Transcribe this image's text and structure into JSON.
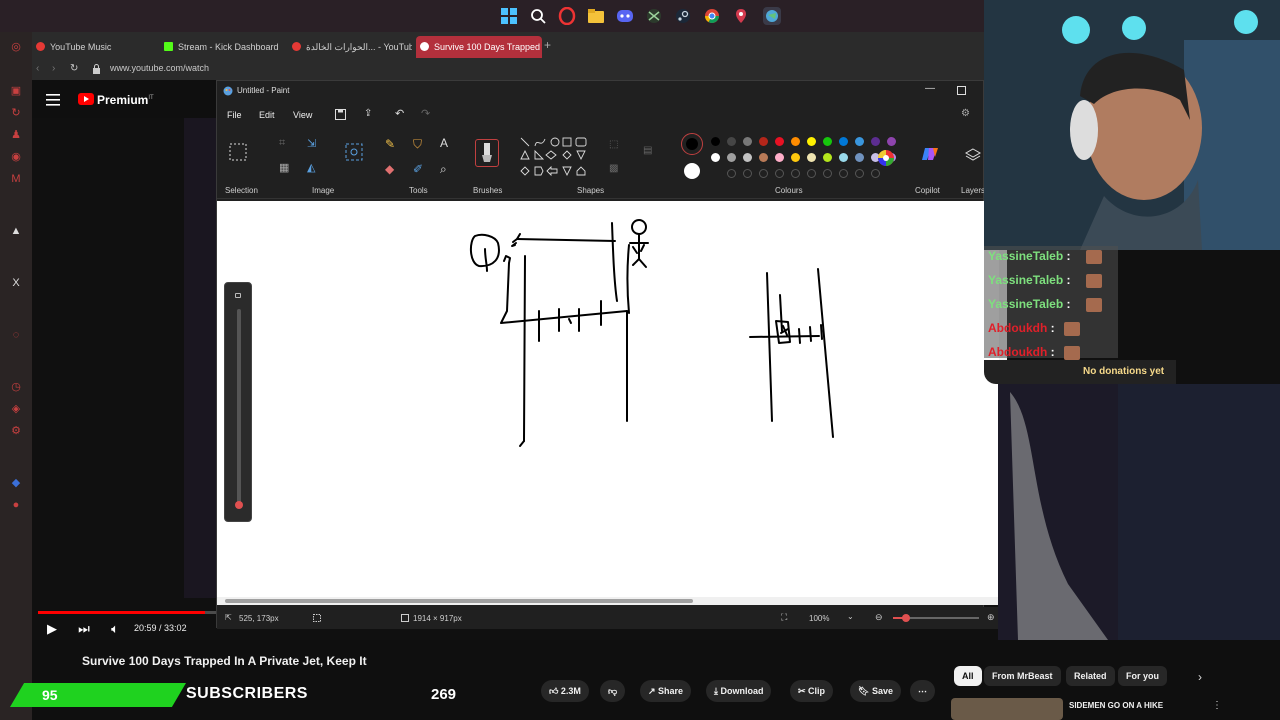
{
  "taskbar": {
    "icons": [
      "windows-icon",
      "search-icon",
      "opera-icon",
      "folder-icon",
      "discord-icon",
      "xbox-icon",
      "steam-icon",
      "chrome-icon",
      "maps-icon",
      "opera-gx-icon"
    ]
  },
  "browser": {
    "tabs": [
      {
        "label": "YouTube Music",
        "icon_color": "#e53935"
      },
      {
        "label": "Stream - Kick Dashboard",
        "icon_color": "#53fc18"
      },
      {
        "label": "الحوارات الخالدة... - YouTube",
        "icon_color": "#e53935"
      },
      {
        "label": "Survive 100 Days Trapped",
        "icon_color": "#ffffff"
      }
    ],
    "url": "www.youtube.com/watch"
  },
  "youtube": {
    "logo_text": "Premium",
    "logo_region": "IT",
    "time_current": "20:59",
    "time_total": "33:02",
    "progress_fraction": 0.135,
    "video_title": "Survive 100 Days Trapped In A Private Jet, Keep It",
    "actions": {
      "likes": "2.3M",
      "share": "Share",
      "download": "Download",
      "clip": "Clip",
      "save": "Save"
    },
    "chips": [
      "All",
      "From MrBeast",
      "Related",
      "For you"
    ],
    "rec_title": "SIDEMEN GO ON A HIKE"
  },
  "paint": {
    "title": "Untitled - Paint",
    "menu": [
      "File",
      "Edit",
      "View"
    ],
    "groups": {
      "selection": "Selection",
      "image": "Image",
      "tools": "Tools",
      "brushes": "Brushes",
      "shapes": "Shapes",
      "colours": "Colours",
      "copilot": "Copilot",
      "layers": "Layers"
    },
    "palette_row1": [
      "#000000",
      "#464646",
      "#787878",
      "#b4261a",
      "#e81123",
      "#ff8c00",
      "#fff100",
      "#16c60c",
      "#0078d7",
      "#3a96dd",
      "#5c2d91",
      "#8e44ad"
    ],
    "palette_row2": [
      "#ffffff",
      "#a0a0a0",
      "#c3c3c3",
      "#b97a57",
      "#ffaec9",
      "#ffc90e",
      "#efe4b0",
      "#b5e61d",
      "#99d9ea",
      "#7092be",
      "#c8bfe7",
      "#b48ce6"
    ],
    "status": {
      "cursor": "525, 173px",
      "canvas_size": "1914 × 917px",
      "zoom": "100%"
    }
  },
  "stream_overlay": {
    "chat": [
      {
        "user": "YassineTaleb",
        "sep": ":",
        "color": "#7ee07e"
      },
      {
        "user": "YassineTaleb",
        "sep": ":",
        "color": "#7ee07e"
      },
      {
        "user": "YassineTaleb",
        "sep": ":",
        "color": "#7ee07e"
      },
      {
        "user": "Abdoukdh",
        "sep": ":",
        "color": "#e0202a"
      },
      {
        "user": "Abdoukdh",
        "sep": ":",
        "color": "#e0202a"
      }
    ],
    "donations": "No donations yet",
    "subs_count": "95",
    "subs_label": "SUBSCRIBERS",
    "subs_goal": "269"
  }
}
